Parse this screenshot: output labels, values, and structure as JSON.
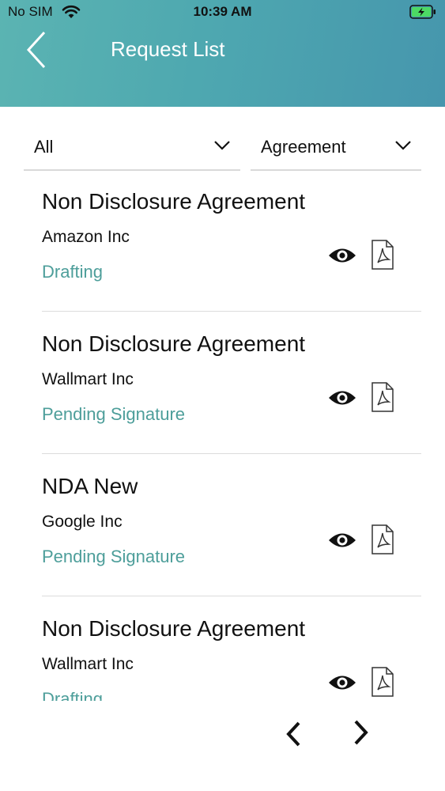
{
  "status_bar": {
    "carrier": "No SIM",
    "time": "10:39 AM"
  },
  "header": {
    "title": "Request List"
  },
  "filters": {
    "status_selected": "All",
    "type_selected": "Agreement"
  },
  "requests": [
    {
      "title": "Non Disclosure Agreement",
      "company": "Amazon Inc",
      "status": "Drafting"
    },
    {
      "title": "Non Disclosure Agreement",
      "company": "Wallmart Inc",
      "status": "Pending Signature"
    },
    {
      "title": "NDA New",
      "company": "Google Inc",
      "status": "Pending Signature"
    },
    {
      "title": "Non Disclosure Agreement",
      "company": "Wallmart Inc",
      "status": "Drafting"
    }
  ],
  "icons": {
    "back": "chevron-left-icon",
    "view": "eye-icon",
    "pdf": "pdf-icon",
    "prev": "chevron-left-icon",
    "next": "chevron-right-icon"
  },
  "colors": {
    "header_gradient_start": "#5bb4b2",
    "header_gradient_end": "#4696ad",
    "status_text": "#4d9e9a",
    "divider": "#dcdcdc"
  }
}
